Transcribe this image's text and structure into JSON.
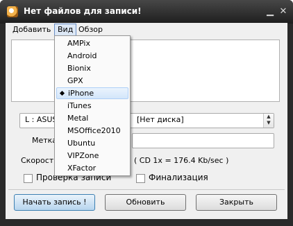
{
  "window": {
    "title": "Нет файлов для записи!",
    "minimize_glyph": "▁",
    "close_glyph": "✕"
  },
  "menubar": {
    "items": [
      "Добавить",
      "Вид",
      "Обзор"
    ]
  },
  "drive_combo": {
    "drive": "L : ASUS",
    "status": "[Нет диска]"
  },
  "label_metka": "Метка",
  "label_speed": "Скорость",
  "speed_info": "( CD 1x = 176.4 Kb/sec )",
  "checkboxes": {
    "verify": "Проверка записи",
    "finalize": "Финализация"
  },
  "buttons": {
    "start": "Начать запись !",
    "refresh": "Обновить",
    "close": "Закрыть"
  },
  "view_menu": {
    "items": [
      "AMPix",
      "Android",
      "Bionix",
      "GPX",
      "iPhone",
      "iTunes",
      "Metal",
      "MSOffice2010",
      "Ubuntu",
      "VIPZone",
      "XFactor"
    ],
    "selected": "iPhone"
  }
}
